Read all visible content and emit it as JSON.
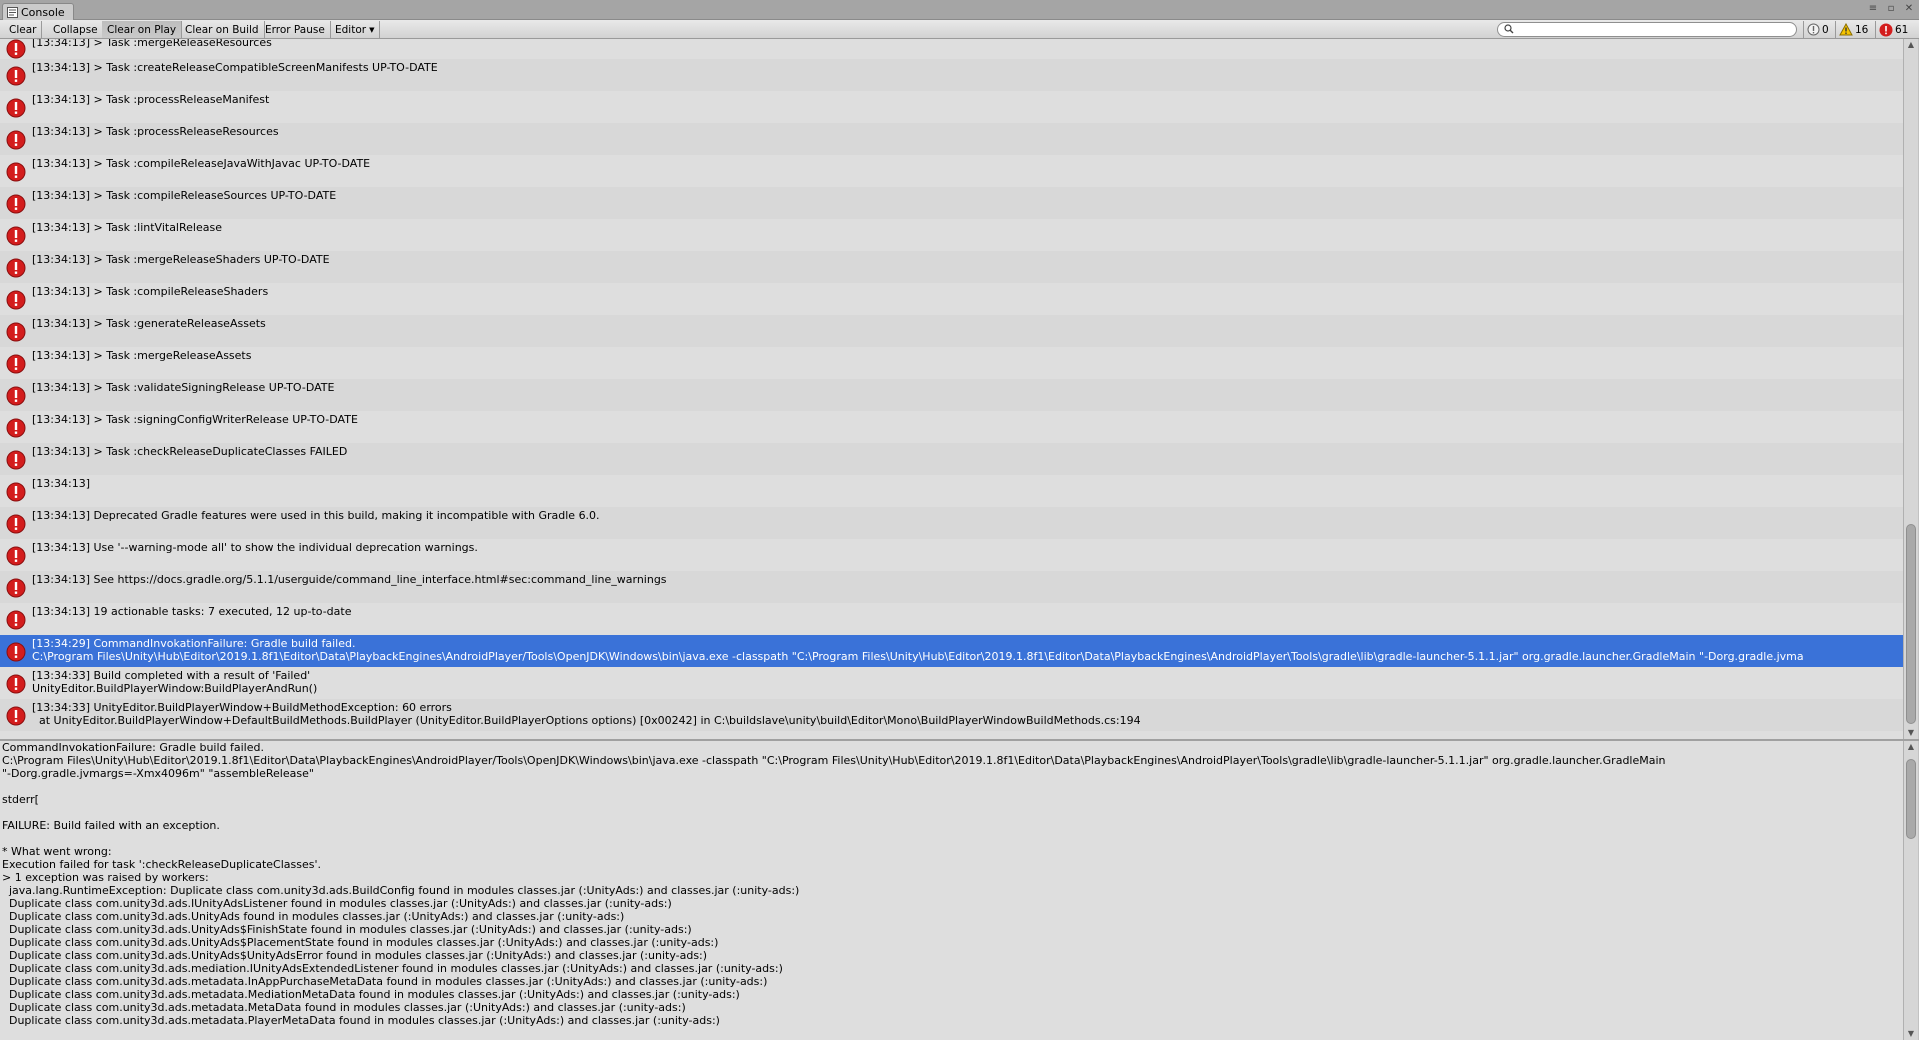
{
  "window": {
    "tab_title": "Console"
  },
  "toolbar": {
    "clear": "Clear",
    "collapse": "Collapse",
    "clear_on_play": "Clear on Play",
    "clear_on_build": "Clear on Build",
    "error_pause": "Error Pause",
    "editor": "Editor",
    "search_value": "",
    "info_count": "0",
    "warning_count": "16",
    "error_count": "61"
  },
  "colors": {
    "selected_row": "#3a72d8",
    "error_icon": "#d31d1d",
    "warning_icon": "#f5c400"
  },
  "log_entries": [
    {
      "line1": "[13:34:13] > Task :mergeReleaseResources",
      "line2": "",
      "type": "error"
    },
    {
      "line1": "[13:34:13] > Task :createReleaseCompatibleScreenManifests UP-TO-DATE",
      "line2": "",
      "type": "error"
    },
    {
      "line1": "[13:34:13] > Task :processReleaseManifest",
      "line2": "",
      "type": "error"
    },
    {
      "line1": "[13:34:13] > Task :processReleaseResources",
      "line2": "",
      "type": "error"
    },
    {
      "line1": "[13:34:13] > Task :compileReleaseJavaWithJavac UP-TO-DATE",
      "line2": "",
      "type": "error"
    },
    {
      "line1": "[13:34:13] > Task :compileReleaseSources UP-TO-DATE",
      "line2": "",
      "type": "error"
    },
    {
      "line1": "[13:34:13] > Task :lintVitalRelease",
      "line2": "",
      "type": "error"
    },
    {
      "line1": "[13:34:13] > Task :mergeReleaseShaders UP-TO-DATE",
      "line2": "",
      "type": "error"
    },
    {
      "line1": "[13:34:13] > Task :compileReleaseShaders",
      "line2": "",
      "type": "error"
    },
    {
      "line1": "[13:34:13] > Task :generateReleaseAssets",
      "line2": "",
      "type": "error"
    },
    {
      "line1": "[13:34:13] > Task :mergeReleaseAssets",
      "line2": "",
      "type": "error"
    },
    {
      "line1": "[13:34:13] > Task :validateSigningRelease UP-TO-DATE",
      "line2": "",
      "type": "error"
    },
    {
      "line1": "[13:34:13] > Task :signingConfigWriterRelease UP-TO-DATE",
      "line2": "",
      "type": "error"
    },
    {
      "line1": "[13:34:13] > Task :checkReleaseDuplicateClasses FAILED",
      "line2": "",
      "type": "error"
    },
    {
      "line1": "[13:34:13]",
      "line2": "",
      "type": "error"
    },
    {
      "line1": "[13:34:13] Deprecated Gradle features were used in this build, making it incompatible with Gradle 6.0.",
      "line2": "",
      "type": "error"
    },
    {
      "line1": "[13:34:13] Use '--warning-mode all' to show the individual deprecation warnings.",
      "line2": "",
      "type": "error"
    },
    {
      "line1": "[13:34:13] See https://docs.gradle.org/5.1.1/userguide/command_line_interface.html#sec:command_line_warnings",
      "line2": "",
      "type": "error"
    },
    {
      "line1": "[13:34:13] 19 actionable tasks: 7 executed, 12 up-to-date",
      "line2": "",
      "type": "error"
    },
    {
      "line1": "[13:34:29] CommandInvokationFailure: Gradle build failed.",
      "line2": "C:\\Program Files\\Unity\\Hub\\Editor\\2019.1.8f1\\Editor\\Data\\PlaybackEngines\\AndroidPlayer/Tools\\OpenJDK\\Windows\\bin\\java.exe -classpath \"C:\\Program Files\\Unity\\Hub\\Editor\\2019.1.8f1\\Editor\\Data\\PlaybackEngines\\AndroidPlayer\\Tools\\gradle\\lib\\gradle-launcher-5.1.1.jar\" org.gradle.launcher.GradleMain \"-Dorg.gradle.jvma",
      "type": "error",
      "selected": true
    },
    {
      "line1": "[13:34:33] Build completed with a result of 'Failed'",
      "line2": "UnityEditor.BuildPlayerWindow:BuildPlayerAndRun()",
      "type": "error"
    },
    {
      "line1": "[13:34:33] UnityEditor.BuildPlayerWindow+BuildMethodException: 60 errors",
      "line2": "  at UnityEditor.BuildPlayerWindow+DefaultBuildMethods.BuildPlayer (UnityEditor.BuildPlayerOptions options) [0x00242] in C:\\buildslave\\unity\\build\\Editor\\Mono\\BuildPlayerWindowBuildMethods.cs:194",
      "type": "error"
    }
  ],
  "detail_lines": [
    "CommandInvokationFailure: Gradle build failed.",
    "C:\\Program Files\\Unity\\Hub\\Editor\\2019.1.8f1\\Editor\\Data\\PlaybackEngines\\AndroidPlayer/Tools\\OpenJDK\\Windows\\bin\\java.exe -classpath \"C:\\Program Files\\Unity\\Hub\\Editor\\2019.1.8f1\\Editor\\Data\\PlaybackEngines\\AndroidPlayer\\Tools\\gradle\\lib\\gradle-launcher-5.1.1.jar\" org.gradle.launcher.GradleMain",
    "\"-Dorg.gradle.jvmargs=-Xmx4096m\" \"assembleRelease\"",
    "",
    "stderr[",
    "",
    "FAILURE: Build failed with an exception.",
    "",
    "* What went wrong:",
    "Execution failed for task ':checkReleaseDuplicateClasses'.",
    "> 1 exception was raised by workers:",
    "  java.lang.RuntimeException: Duplicate class com.unity3d.ads.BuildConfig found in modules classes.jar (:UnityAds:) and classes.jar (:unity-ads:)",
    "  Duplicate class com.unity3d.ads.IUnityAdsListener found in modules classes.jar (:UnityAds:) and classes.jar (:unity-ads:)",
    "  Duplicate class com.unity3d.ads.UnityAds found in modules classes.jar (:UnityAds:) and classes.jar (:unity-ads:)",
    "  Duplicate class com.unity3d.ads.UnityAds$FinishState found in modules classes.jar (:UnityAds:) and classes.jar (:unity-ads:)",
    "  Duplicate class com.unity3d.ads.UnityAds$PlacementState found in modules classes.jar (:UnityAds:) and classes.jar (:unity-ads:)",
    "  Duplicate class com.unity3d.ads.UnityAds$UnityAdsError found in modules classes.jar (:UnityAds:) and classes.jar (:unity-ads:)",
    "  Duplicate class com.unity3d.ads.mediation.IUnityAdsExtendedListener found in modules classes.jar (:UnityAds:) and classes.jar (:unity-ads:)",
    "  Duplicate class com.unity3d.ads.metadata.InAppPurchaseMetaData found in modules classes.jar (:UnityAds:) and classes.jar (:unity-ads:)",
    "  Duplicate class com.unity3d.ads.metadata.MediationMetaData found in modules classes.jar (:UnityAds:) and classes.jar (:unity-ads:)",
    "  Duplicate class com.unity3d.ads.metadata.MetaData found in modules classes.jar (:UnityAds:) and classes.jar (:unity-ads:)",
    "  Duplicate class com.unity3d.ads.metadata.PlayerMetaData found in modules classes.jar (:UnityAds:) and classes.jar (:unity-ads:)"
  ]
}
